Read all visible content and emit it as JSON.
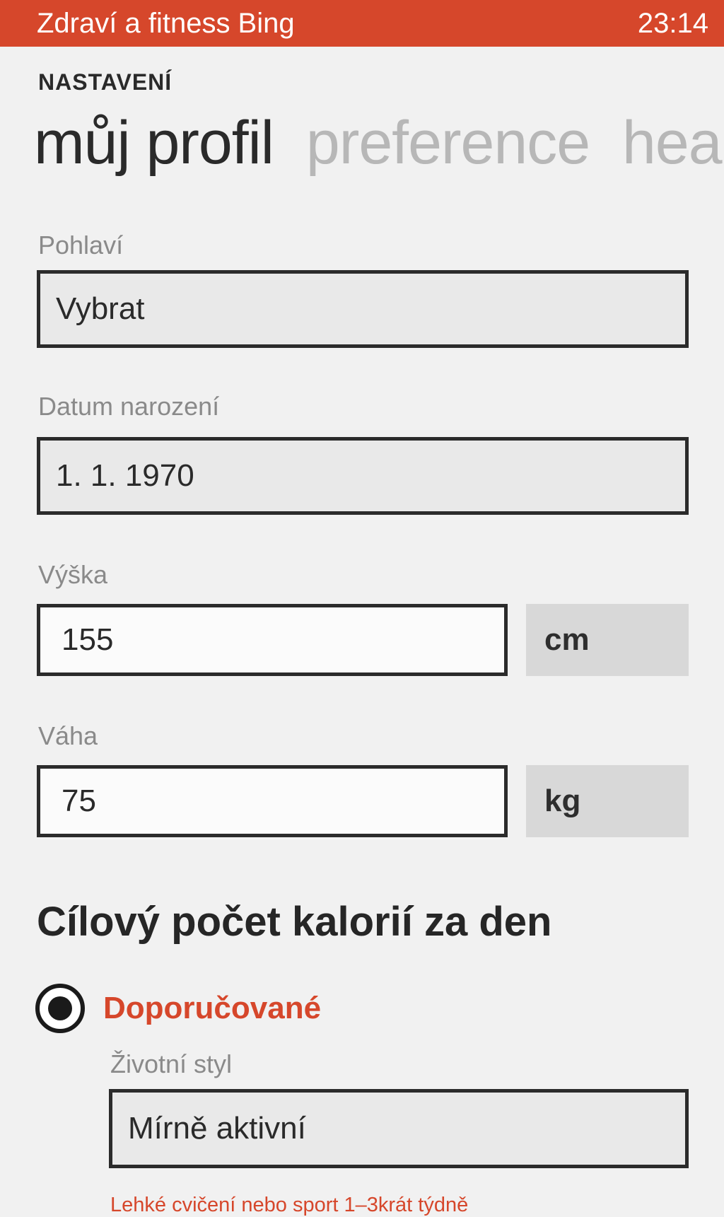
{
  "status_bar": {
    "app_title": "Zdraví a fitness Bing",
    "time": "23:14",
    "accent_color": "#d6472b"
  },
  "header": {
    "section": "NASTAVENÍ"
  },
  "pivot": {
    "tabs": [
      "můj profil",
      "preference",
      "heal"
    ],
    "active_index": 0
  },
  "form": {
    "gender": {
      "label": "Pohlaví",
      "value": "Vybrat"
    },
    "birthdate": {
      "label": "Datum narození",
      "value": "1. 1. 1970"
    },
    "height": {
      "label": "Výška",
      "value": "155",
      "unit": "cm"
    },
    "weight": {
      "label": "Váha",
      "value": "75",
      "unit": "kg"
    }
  },
  "calories": {
    "heading": "Cílový počet kalorií za den",
    "option_recommended": {
      "label": "Doporučované",
      "selected": true
    },
    "lifestyle": {
      "label": "Životní styl",
      "value": "Mírně aktivní",
      "hint": "Lehké cvičení nebo sport 1–3krát týdně"
    }
  }
}
